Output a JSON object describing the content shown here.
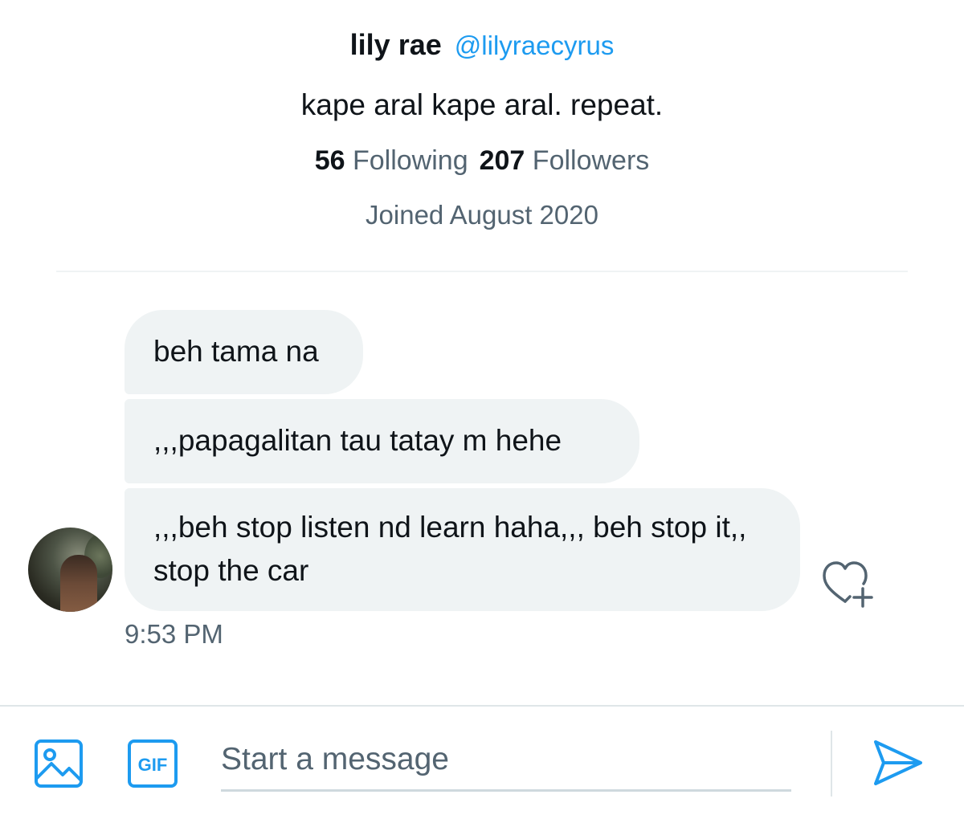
{
  "profile": {
    "display_name": "lily rae",
    "handle": "@lilyraecyrus",
    "bio": "kape aral kape aral. repeat.",
    "following_count": "56",
    "following_label": "Following",
    "followers_count": "207",
    "followers_label": "Followers",
    "joined": "Joined August 2020"
  },
  "conversation": {
    "messages": [
      {
        "text": "beh tama na"
      },
      {
        "text": ",,,papagalitan tau tatay m hehe"
      },
      {
        "text": ",,,beh stop listen nd learn haha,,, beh stop it,, stop the car"
      }
    ],
    "timestamp": "9:53 PM",
    "react_icon": "heart-plus-icon"
  },
  "composer": {
    "placeholder": "Start a message",
    "value": "",
    "media_icon": "image-icon",
    "gif_label": "GIF",
    "send_icon": "send-icon"
  },
  "colors": {
    "accent": "#1d9bf0",
    "text_primary": "#0f1419",
    "text_secondary": "#536471",
    "bubble_bg": "#eff3f4"
  }
}
